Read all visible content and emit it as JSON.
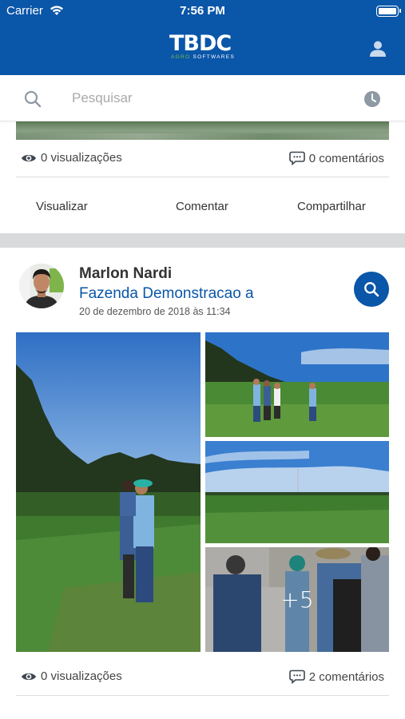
{
  "status_bar": {
    "carrier": "Carrier",
    "time": "7:56 PM"
  },
  "header": {
    "logo_mark": "TBDC",
    "logo_sub_agro": "AGRO",
    "logo_sub_rest": " SOFTWARES"
  },
  "search": {
    "placeholder": "Pesquisar"
  },
  "post_previous": {
    "views": "0 visualizações",
    "comments": "0 comentários",
    "actions": {
      "view": "Visualizar",
      "comment": "Comentar",
      "share": "Compartilhar"
    }
  },
  "post": {
    "author": "Marlon Nardi",
    "farm": "Fazenda Demonstracao a",
    "date": "20 de dezembro de 2018 às 11:34",
    "more_photos": "+5",
    "views": "0 visualizações",
    "comments": "2 comentários"
  },
  "colors": {
    "primary": "#0a56a8",
    "accent_green": "#7ac143",
    "separator": "#d9dadc"
  },
  "icons": [
    "user-icon",
    "search-icon",
    "history-icon",
    "eye-icon",
    "comment-icon",
    "wifi-icon",
    "battery-icon"
  ]
}
